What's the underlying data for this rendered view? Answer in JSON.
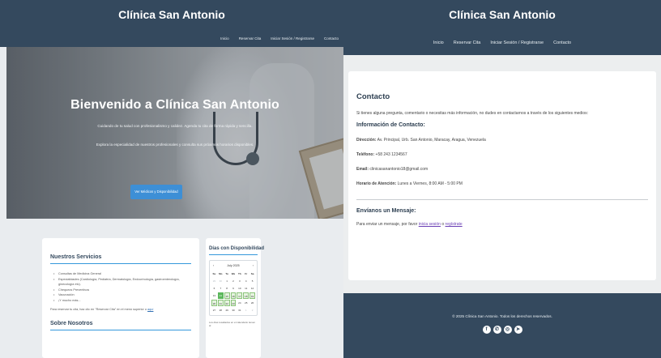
{
  "home": {
    "site_title": "Clínica San Antonio",
    "nav": [
      "Inicio",
      "Reservar Cita",
      "Iniciar Sesión / Registrarse",
      "Contacto"
    ],
    "hero": {
      "title": "Bienvenido a Clínica San Antonio",
      "subtitle": "Cuidando de tu salud con profesionalismo y calidez. Agenda tu cita de forma rápida y sencilla.",
      "text": "Explora la especialidad de nuestros profesionales y consulta sus próximos horarios disponibles.",
      "button": "Ver Médicos y Disponibilidad"
    },
    "services": {
      "title": "Nuestros Servicios",
      "items": [
        "Consultas de Medicina General",
        "Especialidades (Cardiología, Pediatría, Dermatología, Endocrinología, gastroenterología, ginecología etc).",
        "Chequeos Preventivos",
        "Vacunación",
        "¡Y mucho más..."
      ],
      "note_text": "Para reservar tu cita, haz clic en \"Reservar Cita\" en el menú superior o",
      "note_link": "aquí",
      "about_title": "Sobre Nosotros"
    },
    "availability": {
      "title": "Días con Disponibilidad",
      "month_label": "July 2025",
      "weekdays": [
        "Su",
        "Mo",
        "Tu",
        "We",
        "Th",
        "Fr",
        "Sa"
      ],
      "days": [
        [
          "29",
          "30",
          "1",
          "2",
          "3",
          "4",
          "5"
        ],
        [
          "6",
          "7",
          "8",
          "9",
          "10",
          "11",
          "12"
        ],
        [
          "13",
          "14",
          "15",
          "16",
          "17",
          "18",
          "19"
        ],
        [
          "20",
          "21",
          "22",
          "23",
          "24",
          "25",
          "26"
        ],
        [
          "27",
          "28",
          "29",
          "30",
          "31",
          "1",
          "2"
        ]
      ],
      "footnote": "Los días resaltados en el calendario tienen al"
    }
  },
  "contact": {
    "site_title": "Clínica San Antonio",
    "nav": [
      "Inicio",
      "Reservar Cita",
      "Iniciar Sesión / Registrarse",
      "Contacto"
    ],
    "title": "Contacto",
    "intro": "Si tienes alguna pregunta, comentario o necesitas más información, no dudes en contactarnos a través de los siguientes medios:",
    "info_title": "Información de Contacto:",
    "address_label": "Dirección:",
    "address": "Av. Principal, Urb. San Antonio, Maracay, Aragua, Venezuela",
    "phone_label": "Teléfono:",
    "phone": "+58 243 1234567",
    "email_label": "Email:",
    "email": "clinicasanantonio18@gmail.com",
    "hours_label": "Horario de Atención:",
    "hours": "Lunes a Viernes, 8:00 AM - 5:00 PM",
    "message_title": "Envíanos un Mensaje:",
    "message_text": "Para enviar un mensaje, por favor",
    "login_link": "inicia sesión",
    "or": "o",
    "register_link": "regístrate",
    "footer_copy": "© 2025 Clínica San Antonio. Todos los derechos reservados.",
    "social_icons": [
      "facebook-icon",
      "whatsapp-icon",
      "instagram-icon",
      "telegram-icon"
    ]
  },
  "colors": {
    "header": "#34495e",
    "accent": "#3498db",
    "button": "#3d8fd6",
    "available_day": "#5cb85c"
  }
}
